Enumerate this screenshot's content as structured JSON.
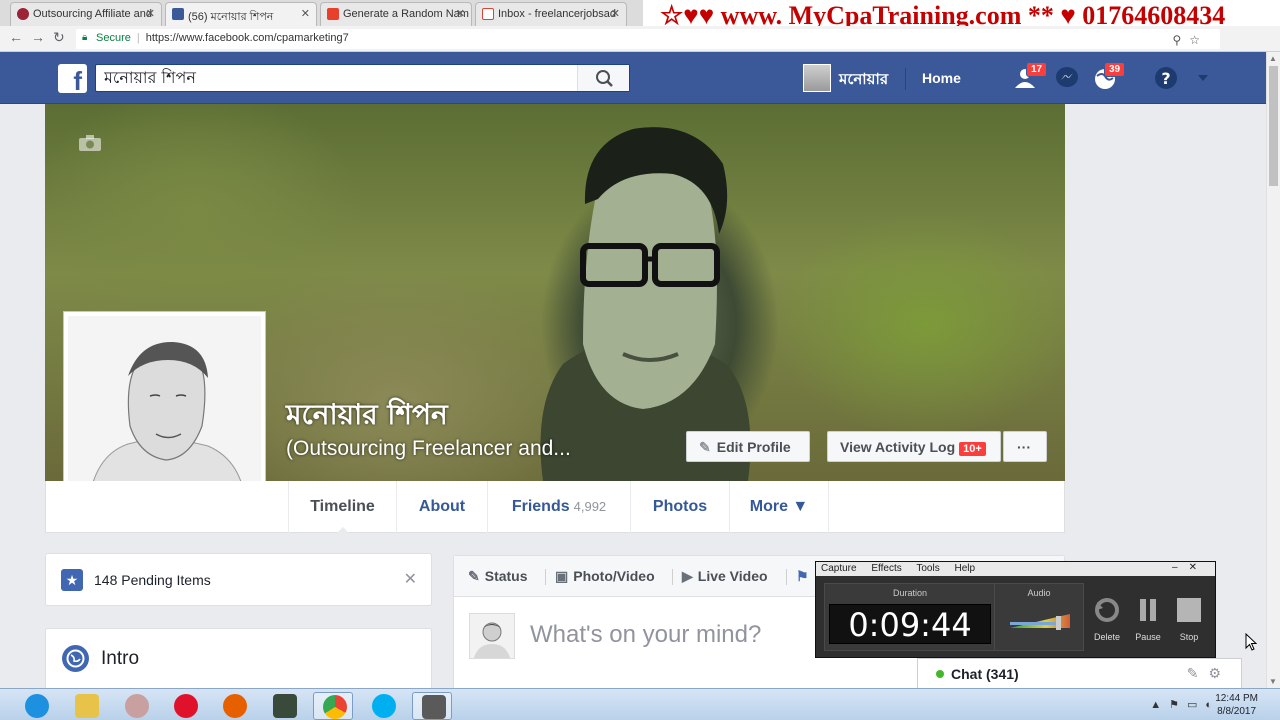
{
  "browser": {
    "tabs": [
      {
        "title": "Outsourcing Affiliate and",
        "icon_color": "#9b2335"
      },
      {
        "title": "(56) মনোয়ার শিপন",
        "icon_color": "#3b5998"
      },
      {
        "title": "Generate a Random Nam",
        "icon_color": "#e8402a"
      },
      {
        "title": "Inbox - freelancerjobsad",
        "icon_color": "#d44638"
      }
    ],
    "promo_banner": "☆♥♥ www. MyCpaTraining.com ** ♥ 01764608434",
    "address": {
      "secure_label": "Secure",
      "url": "https://www.facebook.com/cpamarketing7"
    }
  },
  "fb_header": {
    "logo": "f",
    "search_value": "মনোয়ার শিপন",
    "user_name": "মনোয়ার",
    "home_label": "Home",
    "friend_requests_badge": "17",
    "notifications_badge": "39",
    "icons": [
      "friends-icon",
      "messenger-icon",
      "globe-notifications-icon",
      "help-icon",
      "account-menu-icon"
    ]
  },
  "profile": {
    "name": "মনোয়ার শিপন",
    "subtitle": "(Outsourcing Freelancer and...",
    "edit_profile_label": "Edit Profile",
    "activity_log_label": "View Activity Log",
    "activity_log_badge": "10+",
    "more_dots": "···"
  },
  "timeline_nav": {
    "timeline": "Timeline",
    "about": "About",
    "friends": "Friends",
    "friends_count": "4,992",
    "photos": "Photos",
    "more": "More ▼"
  },
  "left_column": {
    "pending_text": "148 Pending Items",
    "intro_title": "Intro"
  },
  "composer": {
    "tabs": [
      "Status",
      "Photo/Video",
      "Live Video"
    ],
    "placeholder": "What's on your mind?"
  },
  "recorder": {
    "menu": [
      "Capture",
      "Effects",
      "Tools",
      "Help"
    ],
    "duration_label": "Duration",
    "audio_label": "Audio",
    "time": "0:09:44",
    "buttons": [
      "Delete",
      "Pause",
      "Stop"
    ]
  },
  "chat": {
    "label": "Chat (341)"
  },
  "taskbar": {
    "time": "12:44 PM",
    "date": "8/8/2017",
    "apps": [
      {
        "name": "internet-explorer-icon",
        "color": "#1e90e0"
      },
      {
        "name": "file-explorer-icon",
        "color": "#e8c34a"
      },
      {
        "name": "paint-tool-icon",
        "color": "#c8a0a0"
      },
      {
        "name": "opera-icon",
        "color": "#e0112b"
      },
      {
        "name": "firefox-icon",
        "color": "#e66000"
      },
      {
        "name": "nox-icon",
        "color": "#3a4a3a"
      },
      {
        "name": "chrome-icon",
        "color": "#34a853"
      },
      {
        "name": "skype-icon",
        "color": "#00aff0"
      },
      {
        "name": "recorder-app-icon",
        "color": "#5a5a5a"
      }
    ]
  }
}
